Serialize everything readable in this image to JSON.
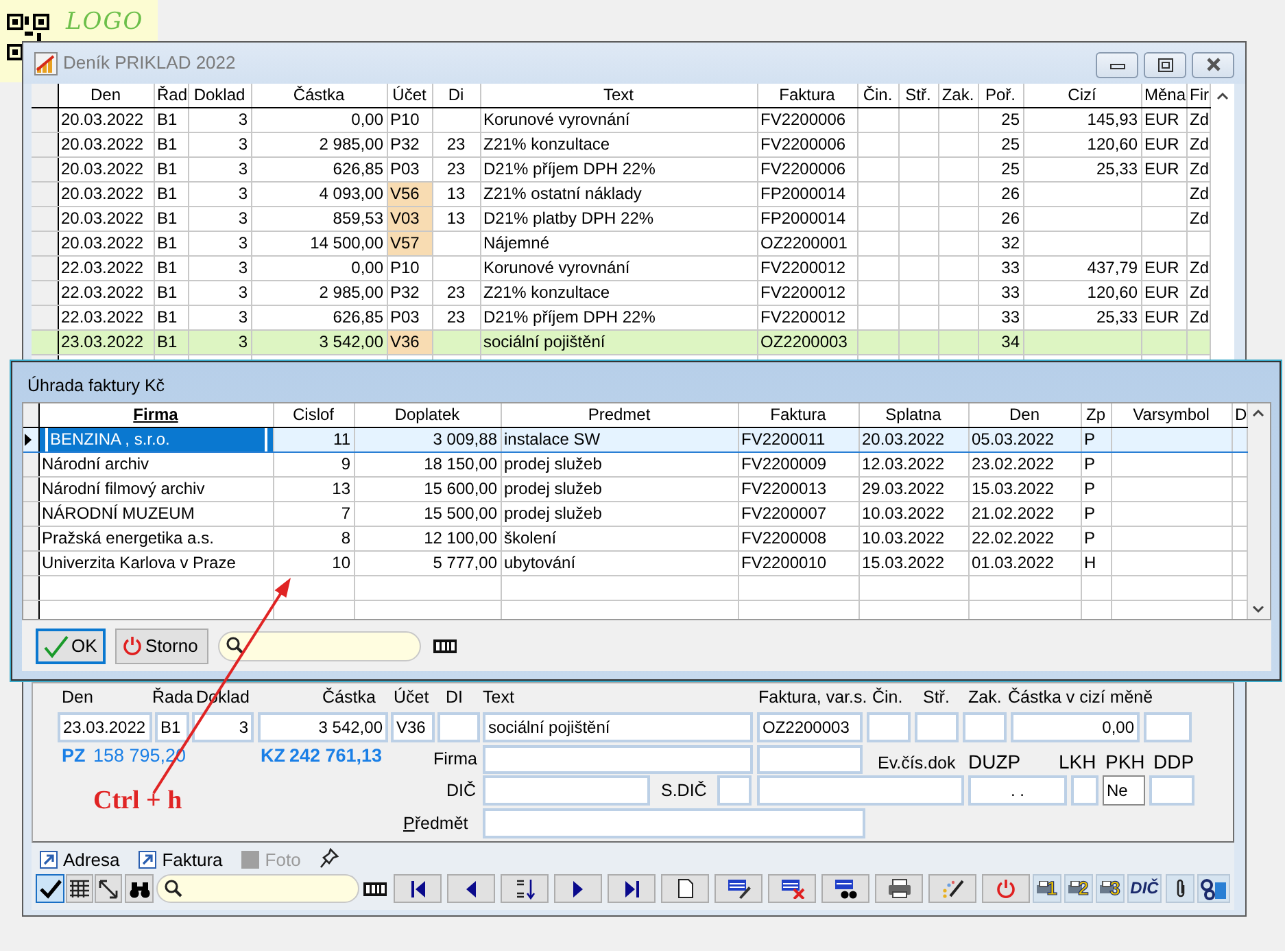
{
  "logo": "LOGO",
  "main_window": {
    "title": "Deník PRIKLAD 2022",
    "columns": [
      "Den",
      "Řad",
      "Doklad",
      "Částka",
      "Účet",
      "Di",
      "Text",
      "Faktura",
      "Čin.",
      "Stř.",
      "Zak.",
      "Poř.",
      "Cizí",
      "Měna",
      "Fir"
    ],
    "rows": [
      {
        "selected": false,
        "account_flagged": false,
        "cells": [
          "20.03.2022",
          "B1",
          "3",
          "0,00",
          "P10",
          null,
          "Korunové vyrovnání",
          "FV2200006",
          null,
          null,
          null,
          "25",
          "145,93",
          "EUR",
          "Zd"
        ]
      },
      {
        "selected": false,
        "account_flagged": false,
        "cells": [
          "20.03.2022",
          "B1",
          "3",
          "2 985,00",
          "P32",
          "23",
          "Z21% konzultace",
          "FV2200006",
          null,
          null,
          null,
          "25",
          "120,60",
          "EUR",
          "Zd"
        ]
      },
      {
        "selected": false,
        "account_flagged": false,
        "cells": [
          "20.03.2022",
          "B1",
          "3",
          "626,85",
          "P03",
          "23",
          "D21% příjem DPH 22%",
          "FV2200006",
          null,
          null,
          null,
          "25",
          "25,33",
          "EUR",
          "Zd"
        ]
      },
      {
        "selected": false,
        "account_flagged": true,
        "cells": [
          "20.03.2022",
          "B1",
          "3",
          "4 093,00",
          "V56",
          "13",
          "Z21% ostatní náklady",
          "FP2000014",
          null,
          null,
          null,
          "26",
          null,
          null,
          "Zd"
        ]
      },
      {
        "selected": false,
        "account_flagged": true,
        "cells": [
          "20.03.2022",
          "B1",
          "3",
          "859,53",
          "V03",
          "13",
          "D21% platby DPH 22%",
          "FP2000014",
          null,
          null,
          null,
          "26",
          null,
          null,
          "Zd"
        ]
      },
      {
        "selected": false,
        "account_flagged": true,
        "cells": [
          "20.03.2022",
          "B1",
          "3",
          "14 500,00",
          "V57",
          null,
          "Nájemné",
          "OZ2200001",
          null,
          null,
          null,
          "32",
          null,
          null,
          null
        ]
      },
      {
        "selected": false,
        "account_flagged": false,
        "cells": [
          "22.03.2022",
          "B1",
          "3",
          "0,00",
          "P10",
          null,
          "Korunové vyrovnání",
          "FV2200012",
          null,
          null,
          null,
          "33",
          "437,79",
          "EUR",
          "Zd"
        ]
      },
      {
        "selected": false,
        "account_flagged": false,
        "cells": [
          "22.03.2022",
          "B1",
          "3",
          "2 985,00",
          "P32",
          "23",
          "Z21% konzultace",
          "FV2200012",
          null,
          null,
          null,
          "33",
          "120,60",
          "EUR",
          "Zd"
        ]
      },
      {
        "selected": false,
        "account_flagged": false,
        "cells": [
          "22.03.2022",
          "B1",
          "3",
          "626,85",
          "P03",
          "23",
          "D21% příjem DPH 22%",
          "FV2200012",
          null,
          null,
          null,
          "33",
          "25,33",
          "EUR",
          "Zd"
        ]
      },
      {
        "selected": true,
        "account_flagged": true,
        "cells": [
          "23.03.2022",
          "B1",
          "3",
          "3 542,00",
          "V36",
          null,
          "sociální pojištění",
          "OZ2200003",
          null,
          null,
          null,
          "34",
          null,
          null,
          null
        ]
      }
    ]
  },
  "dialog": {
    "title": "Úhrada faktury Kč",
    "columns": [
      {
        "label": "Firma",
        "sorted": true
      },
      {
        "label": "Cislof",
        "sorted": false
      },
      {
        "label": "Doplatek",
        "sorted": false
      },
      {
        "label": "Predmet",
        "sorted": false
      },
      {
        "label": "Faktura",
        "sorted": false
      },
      {
        "label": "Splatna",
        "sorted": false
      },
      {
        "label": "Den",
        "sorted": false
      },
      {
        "label": "Zp",
        "sorted": false
      },
      {
        "label": "Varsymbol",
        "sorted": false
      },
      {
        "label": "D",
        "sorted": false
      }
    ],
    "rows": [
      {
        "selected": true,
        "cells": [
          "BENZINA , s.r.o.",
          "11",
          "3 009,88",
          "instalace SW",
          "FV2200011",
          "20.03.2022",
          "05.03.2022",
          "P",
          null,
          null
        ]
      },
      {
        "selected": false,
        "cells": [
          "Národní archiv",
          "9",
          "18 150,00",
          "prodej služeb",
          "FV2200009",
          "12.03.2022",
          "23.02.2022",
          "P",
          null,
          null
        ]
      },
      {
        "selected": false,
        "cells": [
          "Národní filmový archiv",
          "13",
          "15 600,00",
          "prodej služeb",
          "FV2200013",
          "29.03.2022",
          "15.03.2022",
          "P",
          null,
          null
        ]
      },
      {
        "selected": false,
        "cells": [
          "NÁRODNÍ MUZEUM",
          "7",
          "15 500,00",
          "prodej služeb",
          "FV2200007",
          "10.03.2022",
          "21.02.2022",
          "P",
          null,
          null
        ]
      },
      {
        "selected": false,
        "cells": [
          "Pražská energetika a.s.",
          "8",
          "12 100,00",
          "školení",
          "FV2200008",
          "10.03.2022",
          "22.02.2022",
          "P",
          null,
          null
        ]
      },
      {
        "selected": false,
        "cells": [
          "Univerzita Karlova v Praze",
          "10",
          "5 777,00",
          "ubytování",
          "FV2200010",
          "15.03.2022",
          "01.03.2022",
          "H",
          null,
          null
        ]
      }
    ],
    "ok_button": "OK",
    "cancel_button": "Storno"
  },
  "form": {
    "top_labels": [
      "Den",
      "Řada",
      "Doklad",
      "Částka",
      "Účet",
      "DI",
      "Text",
      "Faktura, var.s.",
      "Čin.",
      "Stř.",
      "Zak.",
      "Částka v cizí měně"
    ],
    "top_fields": [
      {
        "kind": "text",
        "value": "23.03.2022"
      },
      {
        "kind": "text",
        "value": "B1"
      },
      {
        "kind": "text",
        "value": "3"
      },
      {
        "kind": "text",
        "value": "3 542,00"
      },
      {
        "kind": "text",
        "value": "V36"
      },
      {
        "kind": "blank"
      },
      {
        "kind": "text",
        "value": "sociální pojištění"
      },
      {
        "kind": "text",
        "value": "OZ2200003"
      },
      {
        "kind": "blank"
      },
      {
        "kind": "blank"
      },
      {
        "kind": "blank"
      },
      {
        "kind": "text",
        "value": "0,00"
      },
      {
        "kind": "blank"
      }
    ],
    "pz": {
      "label": "PZ",
      "value": "158 795,20"
    },
    "kz": {
      "label": "KZ",
      "value": "242 761,13"
    },
    "firma_label": "Firma",
    "info_labels": [
      "Ev.čís.dok",
      "DUZP",
      "LKH",
      "PKH",
      "DDP"
    ],
    "dic_label": "DIČ",
    "sdic_label": "S.DIČ",
    "duzp_value": ". .",
    "pkh_value": "Ne",
    "predmet_label": "Předmět"
  },
  "links": [
    {
      "label": "Adresa",
      "disabled": false
    },
    {
      "label": "Faktura",
      "disabled": false
    },
    {
      "label": "Foto",
      "disabled": true
    }
  ],
  "view_tools": [
    {
      "selected": true
    },
    {
      "selected": false
    },
    {
      "selected": false
    }
  ],
  "print_buttons": [
    "1",
    "2",
    "3"
  ],
  "dic_button": "DIČ",
  "annotation": "Ctrl + h"
}
